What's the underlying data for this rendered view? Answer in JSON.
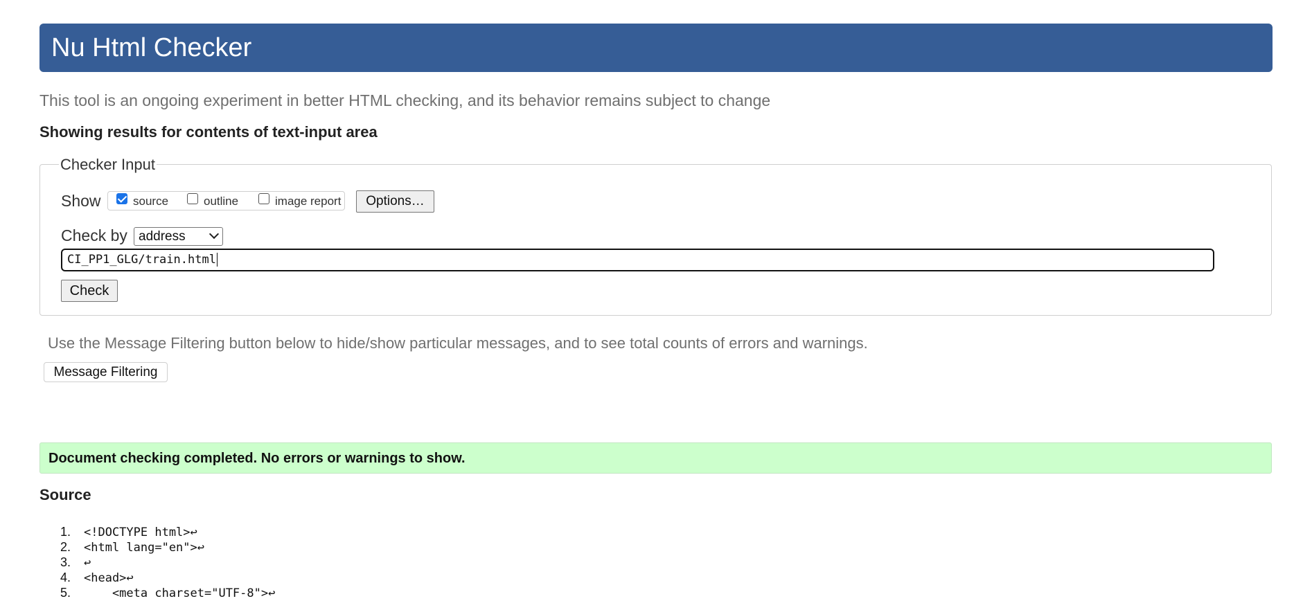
{
  "header": {
    "title": "Nu Html Checker"
  },
  "tagline": "This tool is an ongoing experiment in better HTML checking, and its behavior remains subject to change",
  "results_heading": "Showing results for contents of text-input area",
  "checker_input": {
    "legend": "Checker Input",
    "show_label": "Show",
    "show_options": [
      {
        "label": "source",
        "checked": true
      },
      {
        "label": "outline",
        "checked": false
      },
      {
        "label": "image report",
        "checked": false
      }
    ],
    "options_button": "Options…",
    "check_by_label": "Check by",
    "check_by_value": "address",
    "url_value": "CI_PP1_GLG/train.html",
    "check_button": "Check"
  },
  "filter_info": "Use the Message Filtering button below to hide/show particular messages, and to see total counts of errors and warnings.",
  "filter_button": "Message Filtering",
  "success_message": "Document checking completed. No errors or warnings to show.",
  "source": {
    "heading": "Source",
    "lines": [
      {
        "num": "1.",
        "text": "<!DOCTYPE html>↩"
      },
      {
        "num": "2.",
        "text": "<html lang=\"en\">↩"
      },
      {
        "num": "3.",
        "text": "↩"
      },
      {
        "num": "4.",
        "text": "<head>↩"
      },
      {
        "num": "5.",
        "text": "    <meta charset=\"UTF-8\">↩"
      }
    ]
  },
  "colors": {
    "header_bg": "#365d96",
    "success_bg": "#ccffcc"
  }
}
